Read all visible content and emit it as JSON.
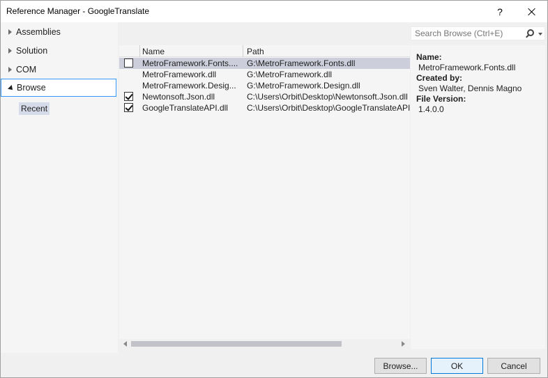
{
  "window": {
    "title": "Reference Manager - GoogleTranslate",
    "help_label": "?"
  },
  "nav": {
    "items": [
      {
        "label": "Assemblies",
        "expanded": false
      },
      {
        "label": "Solution",
        "expanded": false
      },
      {
        "label": "COM",
        "expanded": false
      },
      {
        "label": "Browse",
        "expanded": true,
        "selected": true
      }
    ],
    "sub_items": [
      {
        "label": "Recent",
        "selected": true
      }
    ]
  },
  "list": {
    "columns": [
      "Name",
      "Path"
    ],
    "rows": [
      {
        "checked": false,
        "name": "MetroFramework.Fonts....",
        "path": "G:\\MetroFramework.Fonts.dll",
        "highlighted": true,
        "has_checkbox": true
      },
      {
        "checked": false,
        "name": "MetroFramework.dll",
        "path": "G:\\MetroFramework.dll",
        "highlighted": false,
        "has_checkbox": false
      },
      {
        "checked": false,
        "name": "MetroFramework.Desig...",
        "path": "G:\\MetroFramework.Design.dll",
        "highlighted": false,
        "has_checkbox": false
      },
      {
        "checked": true,
        "name": "Newtonsoft.Json.dll",
        "path": "C:\\Users\\Orbit\\Desktop\\Newtonsoft.Json.dll",
        "highlighted": false,
        "has_checkbox": true
      },
      {
        "checked": true,
        "name": "GoogleTranslateAPI.dll",
        "path": "C:\\Users\\Orbit\\Desktop\\GoogleTranslateAPI.",
        "highlighted": false,
        "has_checkbox": true
      }
    ]
  },
  "search": {
    "placeholder": "Search Browse (Ctrl+E)"
  },
  "details": {
    "name_label": "Name:",
    "name_value": "MetroFramework.Fonts.dll",
    "created_label": "Created by:",
    "created_value": "Sven Walter, Dennis Magno",
    "version_label": "File Version:",
    "version_value": "1.4.0.0"
  },
  "buttons": {
    "browse": "Browse...",
    "ok": "OK",
    "cancel": "Cancel"
  },
  "colors": {
    "selection_border": "#3399ff",
    "row_highlight": "#cccedb",
    "recent_bg": "#d6dbe9",
    "ok_border": "#0078d7"
  }
}
